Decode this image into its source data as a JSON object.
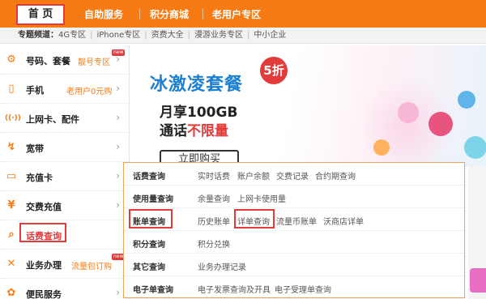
{
  "topnav": {
    "home": "首 页",
    "items": [
      "自助服务",
      "积分商城",
      "老用户专区"
    ]
  },
  "channel": {
    "label": "专题频道：",
    "items": [
      "4G专区",
      "iPhone专区",
      "资费大全",
      "漫游业务专区",
      "中小企业"
    ]
  },
  "sidebar": {
    "items": [
      {
        "icon": "gear-icon",
        "label": "号码、套餐",
        "sub": "靓号专区",
        "new": "new"
      },
      {
        "icon": "phone-icon",
        "label": "手机",
        "sub": "老用户0元购",
        "new": ""
      },
      {
        "icon": "wireless-icon",
        "label": "上网卡、配件",
        "sub": "",
        "new": ""
      },
      {
        "icon": "broadband-icon",
        "label": "宽带",
        "sub": "",
        "new": ""
      },
      {
        "icon": "card-icon",
        "label": "充值卡",
        "sub": "",
        "new": ""
      },
      {
        "icon": "yuan-icon",
        "label": "交费充值",
        "sub": "",
        "new": ""
      },
      {
        "icon": "search-icon",
        "label": "话费查询",
        "sub": "",
        "new": ""
      },
      {
        "icon": "tools-icon",
        "label": "业务办理",
        "sub": "流量包订购",
        "new": "new"
      },
      {
        "icon": "service-icon",
        "label": "便民服务",
        "sub": "",
        "new": ""
      }
    ],
    "arrow": "›"
  },
  "banner": {
    "title": "冰激凌套餐",
    "badge": "5折",
    "line1": "月享100GB",
    "line2_prefix": "通话",
    "line2_highlight": "不限量",
    "button": "立即购买"
  },
  "panel": {
    "rows": [
      {
        "category": "话费查询",
        "links": [
          "实时话费",
          "账户余额",
          "交费记录",
          "合约期查询"
        ]
      },
      {
        "category": "使用量查询",
        "links": [
          "余量查询",
          "上网卡使用量"
        ]
      },
      {
        "category": "账单查询",
        "links": [
          "历史账单",
          "详单查询",
          "流量币账单",
          "沃商店详单"
        ]
      },
      {
        "category": "积分查询",
        "links": [
          "积分兑换"
        ]
      },
      {
        "category": "其它查询",
        "links": [
          "业务办理记录"
        ]
      },
      {
        "category": "电子单查询",
        "links": [
          "电子发票查询及开具",
          "电子受理单查询"
        ]
      }
    ]
  },
  "colors": {
    "accent": "#f77b14",
    "highlight_box": "#e23b3b",
    "banner_title": "#1d7fcf"
  }
}
